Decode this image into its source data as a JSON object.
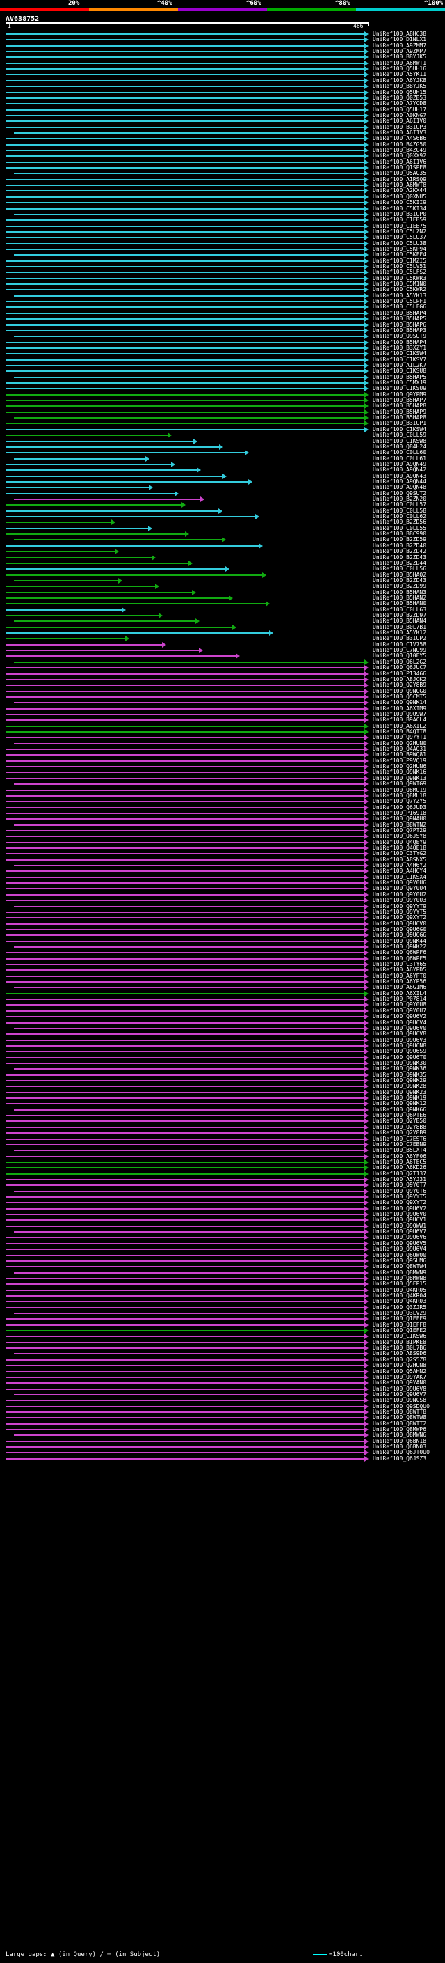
{
  "legend": {
    "labels": [
      "20%",
      "^40%",
      "^60%",
      "^80%",
      "^100%"
    ],
    "colors": [
      "#ff0000",
      "#ff8800",
      "#9900cc",
      "#00aa00",
      "#00cccc"
    ]
  },
  "query": {
    "id": "AV638752",
    "start": "1",
    "end": "466"
  },
  "hits": [
    {
      "id": "UniRef100_A8HC38",
      "color": "cyan"
    },
    {
      "id": "UniRef100_D1NLX1",
      "color": "cyan"
    },
    {
      "id": "UniRef100_A9ZMM7",
      "color": "cyan"
    },
    {
      "id": "UniRef100_A9ZMP7",
      "color": "cyan"
    },
    {
      "id": "UniRef100_B8YJK5",
      "color": "cyan"
    },
    {
      "id": "UniRef100_A6MWT1",
      "color": "cyan"
    },
    {
      "id": "UniRef100_Q5UH16",
      "color": "cyan"
    },
    {
      "id": "UniRef100_A5YK11",
      "color": "cyan"
    },
    {
      "id": "UniRef100_A6YJK8",
      "color": "cyan"
    },
    {
      "id": "UniRef100_B8YJK5",
      "color": "cyan"
    },
    {
      "id": "UniRef100_Q5UH15",
      "color": "cyan"
    },
    {
      "id": "UniRef100_Q0ZB53",
      "color": "cyan"
    },
    {
      "id": "UniRef100_A7YCD8",
      "color": "cyan"
    },
    {
      "id": "UniRef100_Q5UH17",
      "color": "cyan"
    },
    {
      "id": "UniRef100_A0KNG7",
      "color": "cyan"
    },
    {
      "id": "UniRef100_A6I1V0",
      "color": "cyan"
    },
    {
      "id": "UniRef100_B3IUP3",
      "color": "cyan"
    },
    {
      "id": "UniRef100_A6I1V3",
      "color": "cyan"
    },
    {
      "id": "UniRef100_A4S6B6",
      "color": "cyan"
    },
    {
      "id": "UniRef100_B4ZG50",
      "color": "cyan"
    },
    {
      "id": "UniRef100_B4ZG49",
      "color": "cyan"
    },
    {
      "id": "UniRef100_Q0XX92",
      "color": "cyan"
    },
    {
      "id": "UniRef100_A6I1V6",
      "color": "cyan"
    },
    {
      "id": "UniRef100_Q1SPE8",
      "color": "cyan"
    },
    {
      "id": "UniRef100_Q5AG35",
      "color": "cyan"
    },
    {
      "id": "UniRef100_A1RSQ9",
      "color": "cyan"
    },
    {
      "id": "UniRef100_A6MWT8",
      "color": "cyan"
    },
    {
      "id": "UniRef100_A2KX44",
      "color": "cyan"
    },
    {
      "id": "UniRef100_Q0XNU5",
      "color": "cyan"
    },
    {
      "id": "UniRef100_C5KII9",
      "color": "cyan"
    },
    {
      "id": "UniRef100_C5KI34",
      "color": "cyan"
    },
    {
      "id": "UniRef100_B3IUP0",
      "color": "cyan"
    },
    {
      "id": "UniRef100_C1EB59",
      "color": "cyan"
    },
    {
      "id": "UniRef100_C1EB75",
      "color": "cyan"
    },
    {
      "id": "UniRef100_C5LZN2",
      "color": "cyan"
    },
    {
      "id": "UniRef100_C5LU37",
      "color": "cyan"
    },
    {
      "id": "UniRef100_C5LU38",
      "color": "cyan"
    },
    {
      "id": "UniRef100_C5KP94",
      "color": "cyan"
    },
    {
      "id": "UniRef100_C5KFF4",
      "color": "cyan"
    },
    {
      "id": "UniRef100_C1MZI5",
      "color": "cyan"
    },
    {
      "id": "UniRef100_C5LV51",
      "color": "cyan"
    },
    {
      "id": "UniRef100_C5LFS2",
      "color": "cyan"
    },
    {
      "id": "UniRef100_C5KWR3",
      "color": "cyan"
    },
    {
      "id": "UniRef100_C5M1N0",
      "color": "cyan"
    },
    {
      "id": "UniRef100_C5KWR2",
      "color": "cyan"
    },
    {
      "id": "UniRef100_A5YK13",
      "color": "cyan"
    },
    {
      "id": "UniRef100_C5LPF1",
      "color": "cyan"
    },
    {
      "id": "UniRef100_C5LFG6",
      "color": "cyan"
    },
    {
      "id": "UniRef100_B5HAP4",
      "color": "cyan"
    },
    {
      "id": "UniRef100_B5HAP5",
      "color": "cyan"
    },
    {
      "id": "UniRef100_B5HAP6",
      "color": "cyan"
    },
    {
      "id": "UniRef100_B5HAP3",
      "color": "cyan"
    },
    {
      "id": "UniRef100_Q9SUT9",
      "color": "cyan"
    },
    {
      "id": "UniRef100_B5HAP4",
      "color": "cyan"
    },
    {
      "id": "UniRef100_B3XZY1",
      "color": "cyan"
    },
    {
      "id": "UniRef100_C1KSW4",
      "color": "cyan"
    },
    {
      "id": "UniRef100_C1KSV7",
      "color": "cyan"
    },
    {
      "id": "UniRef100_A1L2K7",
      "color": "cyan"
    },
    {
      "id": "UniRef100_C1KSU8",
      "color": "cyan"
    },
    {
      "id": "UniRef100_B5HAP5",
      "color": "cyan"
    },
    {
      "id": "UniRef100_C5MXJ9",
      "color": "cyan"
    },
    {
      "id": "UniRef100_C1KSU9",
      "color": "cyan"
    },
    {
      "id": "UniRef100_Q9YPM9",
      "color": "green"
    },
    {
      "id": "UniRef100_B5HAP7",
      "color": "green"
    },
    {
      "id": "UniRef100_B5HAP8",
      "color": "green"
    },
    {
      "id": "UniRef100_B5HAP9",
      "color": "green"
    },
    {
      "id": "UniRef100_B5HAP8",
      "color": "green"
    },
    {
      "id": "UniRef100_B3IUP1",
      "color": "green"
    },
    {
      "id": "UniRef100_C1KSW4",
      "color": "cyan"
    },
    {
      "id": "UniRef100_C0LL59",
      "color": "green"
    },
    {
      "id": "UniRef100_C1KSW8",
      "color": "cyan"
    },
    {
      "id": "UniRef100_Q84H24",
      "color": "cyan"
    },
    {
      "id": "UniRef100_C0LL60",
      "color": "cyan"
    },
    {
      "id": "UniRef100_C0LL61",
      "color": "cyan"
    },
    {
      "id": "UniRef100_A9QN49",
      "color": "cyan"
    },
    {
      "id": "UniRef100_A9QN42",
      "color": "cyan"
    },
    {
      "id": "UniRef100_A9QN43",
      "color": "cyan"
    },
    {
      "id": "UniRef100_A9QN44",
      "color": "cyan"
    },
    {
      "id": "UniRef100_A9QN48",
      "color": "cyan"
    },
    {
      "id": "UniRef100_Q9SUT2",
      "color": "cyan"
    },
    {
      "id": "UniRef100_B2ZN20",
      "color": "magenta"
    },
    {
      "id": "UniRef100_C0LL57",
      "color": "green"
    },
    {
      "id": "UniRef100_C0LL58",
      "color": "cyan"
    },
    {
      "id": "UniRef100_C0LL62",
      "color": "cyan"
    },
    {
      "id": "UniRef100_B2ZD56",
      "color": "green"
    },
    {
      "id": "UniRef100_C0LL55",
      "color": "cyan"
    },
    {
      "id": "UniRef100_B8C990",
      "color": "green"
    },
    {
      "id": "UniRef100_B2ZD59",
      "color": "green"
    },
    {
      "id": "UniRef100_B2ZD40",
      "color": "cyan"
    },
    {
      "id": "UniRef100_B2ZD42",
      "color": "green"
    },
    {
      "id": "UniRef100_B2ZD43",
      "color": "green"
    },
    {
      "id": "UniRef100_B2ZD44",
      "color": "green"
    },
    {
      "id": "UniRef100_C0LL56",
      "color": "cyan"
    },
    {
      "id": "UniRef100_B5HAQ2",
      "color": "green"
    },
    {
      "id": "UniRef100_B2ZD43",
      "color": "green"
    },
    {
      "id": "UniRef100_B2ZD99",
      "color": "green"
    },
    {
      "id": "UniRef100_B5HAN3",
      "color": "green"
    },
    {
      "id": "UniRef100_B5HAN2",
      "color": "green"
    },
    {
      "id": "UniRef100_B5HAN0",
      "color": "green"
    },
    {
      "id": "UniRef100_C0LL63",
      "color": "cyan"
    },
    {
      "id": "UniRef100_B2ZD97",
      "color": "green"
    },
    {
      "id": "UniRef100_B5HAN4",
      "color": "green"
    },
    {
      "id": "UniRef100_B0L7B1",
      "color": "green"
    },
    {
      "id": "UniRef100_A5YK12",
      "color": "cyan"
    },
    {
      "id": "UniRef100_B3IUP2",
      "color": "green"
    },
    {
      "id": "UniRef100_C1V758",
      "color": "magenta"
    },
    {
      "id": "UniRef100_C7NU99",
      "color": "magenta"
    },
    {
      "id": "UniRef100_Q10EY5",
      "color": "magenta"
    },
    {
      "id": "UniRef100_Q6L2G2",
      "color": "green"
    },
    {
      "id": "UniRef100_Q6JUC7",
      "color": "magenta"
    },
    {
      "id": "UniRef100_P13466",
      "color": "magenta"
    },
    {
      "id": "UniRef100_A8JCK2",
      "color": "magenta"
    },
    {
      "id": "UniRef100_Q2Y8B9",
      "color": "magenta"
    },
    {
      "id": "UniRef100_Q9NGG0",
      "color": "magenta"
    },
    {
      "id": "UniRef100_Q5CMT5",
      "color": "magenta"
    },
    {
      "id": "UniRef100_Q9NK14",
      "color": "magenta"
    },
    {
      "id": "UniRef100_A6XIM9",
      "color": "magenta"
    },
    {
      "id": "UniRef100_Q9U9W7",
      "color": "magenta"
    },
    {
      "id": "UniRef100_B9ACL4",
      "color": "magenta"
    },
    {
      "id": "UniRef100_A6XIL2",
      "color": "green"
    },
    {
      "id": "UniRef100_B4QTT8",
      "color": "green"
    },
    {
      "id": "UniRef100_Q97YT1",
      "color": "magenta"
    },
    {
      "id": "UniRef100_Q2HUN0",
      "color": "magenta"
    },
    {
      "id": "UniRef100_Q4AQ31",
      "color": "magenta"
    },
    {
      "id": "UniRef100_B9WQ81",
      "color": "magenta"
    },
    {
      "id": "UniRef100_P9VQ19",
      "color": "magenta"
    },
    {
      "id": "UniRef100_Q2HUN6",
      "color": "magenta"
    },
    {
      "id": "UniRef100_Q9NK16",
      "color": "magenta"
    },
    {
      "id": "UniRef100_Q9NK13",
      "color": "magenta"
    },
    {
      "id": "UniRef100_Q9WTG9",
      "color": "magenta"
    },
    {
      "id": "UniRef100_Q8MU19",
      "color": "magenta"
    },
    {
      "id": "UniRef100_Q8MU18",
      "color": "magenta"
    },
    {
      "id": "UniRef100_Q7YZY5",
      "color": "magenta"
    },
    {
      "id": "UniRef100_Q6JUD3",
      "color": "magenta"
    },
    {
      "id": "UniRef100_P16918",
      "color": "magenta"
    },
    {
      "id": "UniRef100_Q9NAH0",
      "color": "magenta"
    },
    {
      "id": "UniRef100_B8WTN2",
      "color": "magenta"
    },
    {
      "id": "UniRef100_Q7PT29",
      "color": "magenta"
    },
    {
      "id": "UniRef100_Q6JSY8",
      "color": "magenta"
    },
    {
      "id": "UniRef100_Q4QEY9",
      "color": "magenta"
    },
    {
      "id": "UniRef100_Q4QE18",
      "color": "magenta"
    },
    {
      "id": "UniRef100_C3TYG2",
      "color": "magenta"
    },
    {
      "id": "UniRef100_A8SNX5",
      "color": "magenta"
    },
    {
      "id": "UniRef100_A4H6Y2",
      "color": "magenta"
    },
    {
      "id": "UniRef100_A4H6Y4",
      "color": "magenta"
    },
    {
      "id": "UniRef100_C1KSX4",
      "color": "magenta"
    },
    {
      "id": "UniRef100_Q9Y0U6",
      "color": "magenta"
    },
    {
      "id": "UniRef100_Q9Y0U4",
      "color": "magenta"
    },
    {
      "id": "UniRef100_Q9Y0U2",
      "color": "magenta"
    },
    {
      "id": "UniRef100_Q9Y0U3",
      "color": "magenta"
    },
    {
      "id": "UniRef100_Q9YYT9",
      "color": "magenta"
    },
    {
      "id": "UniRef100_Q9YYT5",
      "color": "magenta"
    },
    {
      "id": "UniRef100_Q9XYT2",
      "color": "magenta"
    },
    {
      "id": "UniRef100_Q9U6V0",
      "color": "magenta"
    },
    {
      "id": "UniRef100_Q9U6G0",
      "color": "magenta"
    },
    {
      "id": "UniRef100_Q9U6G6",
      "color": "magenta"
    },
    {
      "id": "UniRef100_Q9NK44",
      "color": "magenta"
    },
    {
      "id": "UniRef100_Q9NK22",
      "color": "magenta"
    },
    {
      "id": "UniRef100_Q6WPF6",
      "color": "magenta"
    },
    {
      "id": "UniRef100_Q6WPF5",
      "color": "magenta"
    },
    {
      "id": "UniRef100_C3TY65",
      "color": "magenta"
    },
    {
      "id": "UniRef100_A6YPD5",
      "color": "magenta"
    },
    {
      "id": "UniRef100_A6YPT0",
      "color": "magenta"
    },
    {
      "id": "UniRef100_A6YP56",
      "color": "magenta"
    },
    {
      "id": "UniRef100_A6G1M6",
      "color": "magenta"
    },
    {
      "id": "UniRef100_A6XIL4",
      "color": "green"
    },
    {
      "id": "UniRef100_P07814",
      "color": "magenta"
    },
    {
      "id": "UniRef100_Q9Y0U8",
      "color": "magenta"
    },
    {
      "id": "UniRef100_Q9Y0U7",
      "color": "magenta"
    },
    {
      "id": "UniRef100_Q9U6V2",
      "color": "magenta"
    },
    {
      "id": "UniRef100_Q9U6V4",
      "color": "magenta"
    },
    {
      "id": "UniRef100_Q9U6V0",
      "color": "magenta"
    },
    {
      "id": "UniRef100_Q9U6V8",
      "color": "magenta"
    },
    {
      "id": "UniRef100_Q9U6V3",
      "color": "magenta"
    },
    {
      "id": "UniRef100_Q9U6N8",
      "color": "magenta"
    },
    {
      "id": "UniRef100_Q9U6S9",
      "color": "magenta"
    },
    {
      "id": "UniRef100_Q9U6T0",
      "color": "magenta"
    },
    {
      "id": "UniRef100_Q9NK30",
      "color": "magenta"
    },
    {
      "id": "UniRef100_Q9NK36",
      "color": "magenta"
    },
    {
      "id": "UniRef100_Q9NK35",
      "color": "magenta"
    },
    {
      "id": "UniRef100_Q9NK29",
      "color": "magenta"
    },
    {
      "id": "UniRef100_Q9NK28",
      "color": "magenta"
    },
    {
      "id": "UniRef100_Q9NK23",
      "color": "magenta"
    },
    {
      "id": "UniRef100_Q9NK19",
      "color": "magenta"
    },
    {
      "id": "UniRef100_Q9NK12",
      "color": "magenta"
    },
    {
      "id": "UniRef100_Q9NK66",
      "color": "magenta"
    },
    {
      "id": "UniRef100_Q6PTE6",
      "color": "magenta"
    },
    {
      "id": "UniRef100_Q2YB50",
      "color": "magenta"
    },
    {
      "id": "UniRef100_Q2Y8B8",
      "color": "magenta"
    },
    {
      "id": "UniRef100_Q2Y8B9",
      "color": "magenta"
    },
    {
      "id": "UniRef100_C7EST6",
      "color": "magenta"
    },
    {
      "id": "UniRef100_C7EBN9",
      "color": "magenta"
    },
    {
      "id": "UniRef100_B5LXT4",
      "color": "magenta"
    },
    {
      "id": "UniRef100_A6YF06",
      "color": "magenta"
    },
    {
      "id": "UniRef100_A6TEC5",
      "color": "green"
    },
    {
      "id": "UniRef100_A6KD26",
      "color": "green"
    },
    {
      "id": "UniRef100_Q2T137",
      "color": "green"
    },
    {
      "id": "UniRef100_A5YJ31",
      "color": "magenta"
    },
    {
      "id": "UniRef100_Q9Y0T7",
      "color": "magenta"
    },
    {
      "id": "UniRef100_Q9Y0T6",
      "color": "magenta"
    },
    {
      "id": "UniRef100_Q9YYT5",
      "color": "magenta"
    },
    {
      "id": "UniRef100_Q9XYT2",
      "color": "magenta"
    },
    {
      "id": "UniRef100_Q9U6V2",
      "color": "magenta"
    },
    {
      "id": "UniRef100_Q9U6V0",
      "color": "magenta"
    },
    {
      "id": "UniRef100_Q9U6V1",
      "color": "magenta"
    },
    {
      "id": "UniRef100_Q9QWW1",
      "color": "magenta"
    },
    {
      "id": "UniRef100_Q9U6V7",
      "color": "magenta"
    },
    {
      "id": "UniRef100_Q9U6V6",
      "color": "magenta"
    },
    {
      "id": "UniRef100_Q9U6V5",
      "color": "magenta"
    },
    {
      "id": "UniRef100_Q9U6V4",
      "color": "magenta"
    },
    {
      "id": "UniRef100_Q6UW00",
      "color": "magenta"
    },
    {
      "id": "UniRef100_Q95UM6",
      "color": "magenta"
    },
    {
      "id": "UniRef100_Q8WTW4",
      "color": "magenta"
    },
    {
      "id": "UniRef100_Q8MWN9",
      "color": "magenta"
    },
    {
      "id": "UniRef100_Q8MWN8",
      "color": "magenta"
    },
    {
      "id": "UniRef100_Q5EP15",
      "color": "magenta"
    },
    {
      "id": "UniRef100_Q4KR05",
      "color": "magenta"
    },
    {
      "id": "UniRef100_Q4KR04",
      "color": "magenta"
    },
    {
      "id": "UniRef100_Q4KR03",
      "color": "magenta"
    },
    {
      "id": "UniRef100_Q3ZJR5",
      "color": "magenta"
    },
    {
      "id": "UniRef100_Q3LV29",
      "color": "magenta"
    },
    {
      "id": "UniRef100_Q1EFF9",
      "color": "magenta"
    },
    {
      "id": "UniRef100_Q1EFF8",
      "color": "magenta"
    },
    {
      "id": "UniRef100_Q1EFE2",
      "color": "green"
    },
    {
      "id": "UniRef100_C1KSW6",
      "color": "magenta"
    },
    {
      "id": "UniRef100_B1PKE8",
      "color": "magenta"
    },
    {
      "id": "UniRef100_B0L7B6",
      "color": "magenta"
    },
    {
      "id": "UniRef100_A8S9D6",
      "color": "magenta"
    },
    {
      "id": "UniRef100_Q2S5Z8",
      "color": "magenta"
    },
    {
      "id": "UniRef100_Q2HUN8",
      "color": "magenta"
    },
    {
      "id": "UniRef100_Q5AHN2",
      "color": "magenta"
    },
    {
      "id": "UniRef100_Q9YAK7",
      "color": "magenta"
    },
    {
      "id": "UniRef100_Q9YAN0",
      "color": "magenta"
    },
    {
      "id": "UniRef100_Q9U6V8",
      "color": "magenta"
    },
    {
      "id": "UniRef100_Q9U6V7",
      "color": "magenta"
    },
    {
      "id": "UniRef100_Q9NCS8",
      "color": "magenta"
    },
    {
      "id": "UniRef100_Q9SDQU0",
      "color": "magenta"
    },
    {
      "id": "UniRef100_Q8WTT8",
      "color": "magenta"
    },
    {
      "id": "UniRef100_Q8WTW8",
      "color": "magenta"
    },
    {
      "id": "UniRef100_Q8WTT2",
      "color": "magenta"
    },
    {
      "id": "UniRef100_Q8MWP6",
      "color": "magenta"
    },
    {
      "id": "UniRef100_Q8MWN6",
      "color": "magenta"
    },
    {
      "id": "UniRef100_Q6BN18",
      "color": "magenta"
    },
    {
      "id": "UniRef100_Q6BN03",
      "color": "magenta"
    },
    {
      "id": "UniRef100_Q6JT0U0",
      "color": "magenta"
    },
    {
      "id": "UniRef100_Q6JSZ3",
      "color": "magenta"
    }
  ],
  "footer": {
    "gaps_text": "Large gaps: ▲ (in Query) / ─ (in Subject)",
    "scale_text": "=100char."
  }
}
